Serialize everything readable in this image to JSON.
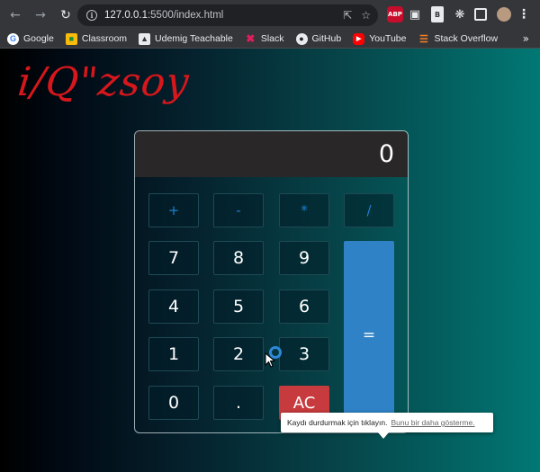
{
  "browser": {
    "url_host": "127.0.0.1",
    "url_rest": ":5500/index.html",
    "extensions": [
      "ABP",
      "B"
    ]
  },
  "bookmarks": [
    {
      "label": "Google",
      "icon": "google-icon"
    },
    {
      "label": "Classroom",
      "icon": "classroom-icon"
    },
    {
      "label": "Udemig Teachable",
      "icon": "teachable-icon"
    },
    {
      "label": "Slack",
      "icon": "slack-icon"
    },
    {
      "label": "GitHub",
      "icon": "github-icon"
    },
    {
      "label": "YouTube",
      "icon": "youtube-icon"
    },
    {
      "label": "Stack Overflow",
      "icon": "stackoverflow-icon"
    }
  ],
  "page": {
    "logo": "i/Q\"zsoy"
  },
  "calculator": {
    "display": "0",
    "operators": [
      "+",
      "-",
      "*",
      "/"
    ],
    "digits": [
      "7",
      "8",
      "9",
      "4",
      "5",
      "6",
      "1",
      "2",
      "3",
      "0",
      "."
    ],
    "clear_label": "AC",
    "equals_label": "="
  },
  "tooltip": {
    "text": "Kaydı durdurmak için tıklayın.",
    "link": "Bunu bir daha gösterme."
  },
  "colors": {
    "accent_blue": "#2f82c5",
    "clear_red": "#c73a3d",
    "logo_red": "#d7171c"
  }
}
